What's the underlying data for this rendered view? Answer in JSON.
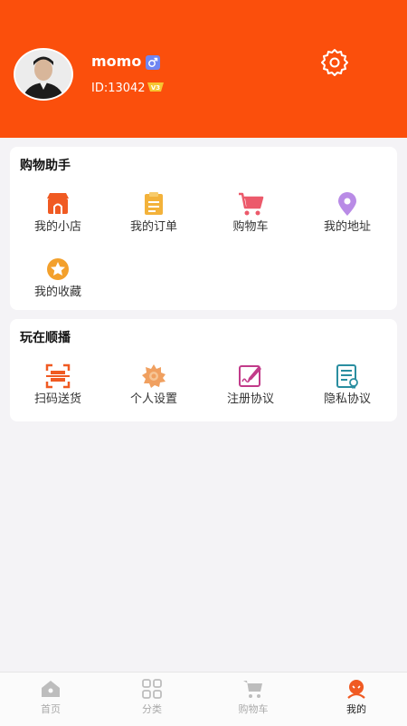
{
  "user": {
    "name": "momo",
    "id_text": "ID:13042",
    "vip_level": "V3",
    "gender_icon": "male-icon"
  },
  "shopping_assistant": {
    "title": "购物助手",
    "items": [
      {
        "label": "我的小店",
        "icon": "shop-icon",
        "color": "#f05a22"
      },
      {
        "label": "我的订单",
        "icon": "clipboard-icon",
        "color": "#f3b23a"
      },
      {
        "label": "购物车",
        "icon": "cart-icon",
        "color": "#ec5a6b"
      },
      {
        "label": "我的地址",
        "icon": "location-pin-icon",
        "color": "#b98be6"
      },
      {
        "label": "我的收藏",
        "icon": "star-icon",
        "color": "#f3a02c"
      }
    ]
  },
  "play": {
    "title": "玩在顺播",
    "items": [
      {
        "label": "扫码送货",
        "icon": "scan-icon",
        "color": "#f05a22"
      },
      {
        "label": "个人设置",
        "icon": "gear-flower-icon",
        "color": "#f0a060"
      },
      {
        "label": "注册协议",
        "icon": "signature-icon",
        "color": "#c23b8a"
      },
      {
        "label": "隐私协议",
        "icon": "document-icon",
        "color": "#2a8ea0"
      }
    ]
  },
  "tabbar": {
    "tabs": [
      {
        "label": "首页",
        "icon": "home-icon"
      },
      {
        "label": "分类",
        "icon": "grid-icon"
      },
      {
        "label": "购物车",
        "icon": "cart-icon"
      },
      {
        "label": "我的",
        "icon": "profile-icon",
        "active": true
      }
    ]
  },
  "colors": {
    "header": "#fb4f0c",
    "background": "#f4f3f6",
    "active_tab_icon": "#f05a22"
  }
}
